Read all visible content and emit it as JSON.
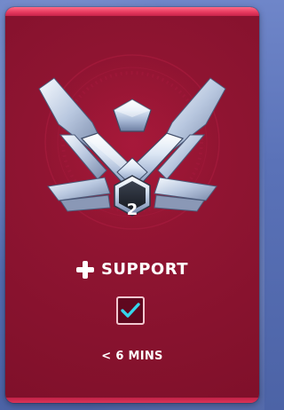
{
  "role": {
    "name": "SUPPORT",
    "icon": "plus-icon"
  },
  "rank": {
    "tier_icon": "rank-emblem-icon",
    "division": "2"
  },
  "queue": {
    "selected": true,
    "estimate": "< 6 MINS"
  },
  "colors": {
    "card": "#8e1431",
    "card_border": "#e5385d",
    "check": "#35d6ec",
    "background": "#5a72b8"
  }
}
